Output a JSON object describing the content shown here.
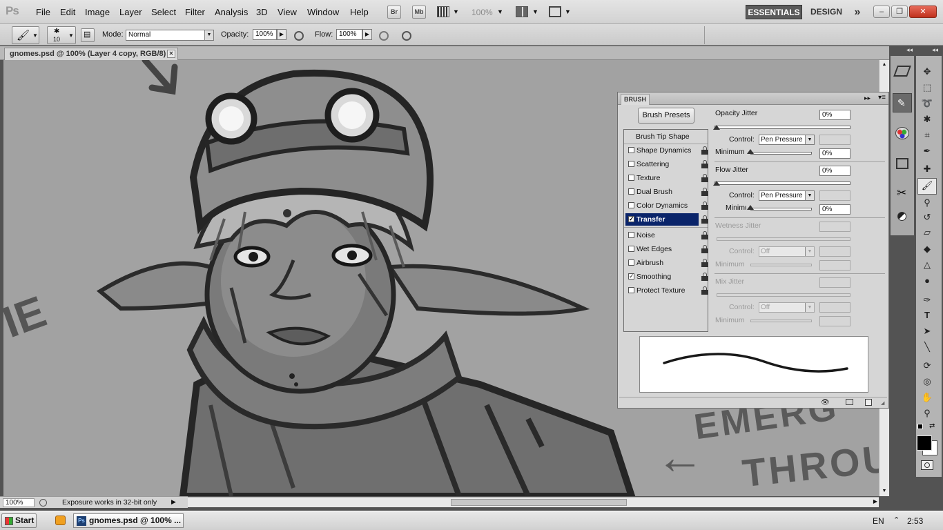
{
  "app": {
    "logo": "Ps"
  },
  "menu": [
    "File",
    "Edit",
    "Image",
    "Layer",
    "Select",
    "Filter",
    "Analysis",
    "3D",
    "View",
    "Window",
    "Help"
  ],
  "appbar": {
    "bridge": "Br",
    "minibridge": "Mb",
    "zoom": "100%"
  },
  "workspaces": {
    "essentials": "ESSENTIALS",
    "design": "DESIGN",
    "more": "»"
  },
  "window_controls": {
    "minimize": "–",
    "restore": "❐",
    "close": "✕"
  },
  "options": {
    "brush_size": "10",
    "mode_label": "Mode:",
    "mode_value": "Normal",
    "opacity_label": "Opacity:",
    "opacity_value": "100%",
    "flow_label": "Flow:",
    "flow_value": "100%"
  },
  "document": {
    "tab_title": "gnomes.psd @ 100% (Layer 4 copy, RGB/8)",
    "close": "✕"
  },
  "status": {
    "zoom": "100%",
    "message": "Exposure works in 32-bit only"
  },
  "canvas_text": {
    "left": "IE",
    "right_top": "EMERG",
    "right_bottom": "THROU",
    "arrow": "←"
  },
  "brush_panel": {
    "tab": "BRUSH",
    "presets_button": "Brush Presets",
    "tip_shape": "Brush Tip Shape",
    "items": [
      {
        "label": "Shape Dynamics",
        "checked": false,
        "mark": ""
      },
      {
        "label": "Scattering",
        "checked": false,
        "mark": ""
      },
      {
        "label": "Texture",
        "checked": false,
        "mark": ""
      },
      {
        "label": "Dual Brush",
        "checked": false,
        "mark": ""
      },
      {
        "label": "Color Dynamics",
        "checked": false,
        "mark": ""
      },
      {
        "label": "Transfer",
        "checked": true,
        "mark": "✓"
      },
      {
        "label": "Noise",
        "checked": false,
        "mark": ""
      },
      {
        "label": "Wet Edges",
        "checked": false,
        "mark": ""
      },
      {
        "label": "Airbrush",
        "checked": false,
        "mark": ""
      },
      {
        "label": "Smoothing",
        "checked": true,
        "mark": "✓"
      },
      {
        "label": "Protect Texture",
        "checked": false,
        "mark": ""
      }
    ],
    "opacity_jitter": {
      "label": "Opacity Jitter",
      "value": "0%",
      "control_label": "Control:",
      "control_value": "Pen Pressure",
      "min_label": "Minimum",
      "min_value": "0%"
    },
    "flow_jitter": {
      "label": "Flow Jitter",
      "value": "0%",
      "control_label": "Control:",
      "control_value": "Pen Pressure",
      "min_label": "Minimum",
      "min_value": "0%"
    },
    "wetness_jitter": {
      "label": "Wetness Jitter",
      "control_label": "Control:",
      "control_value": "Off",
      "min_label": "Minimum"
    },
    "mix_jitter": {
      "label": "Mix Jitter",
      "control_label": "Control:",
      "control_value": "Off",
      "min_label": "Minimum"
    }
  },
  "taskbar": {
    "start": "Start",
    "task": "gnomes.psd @ 100% ...",
    "lang": "EN",
    "time": "2:53"
  }
}
